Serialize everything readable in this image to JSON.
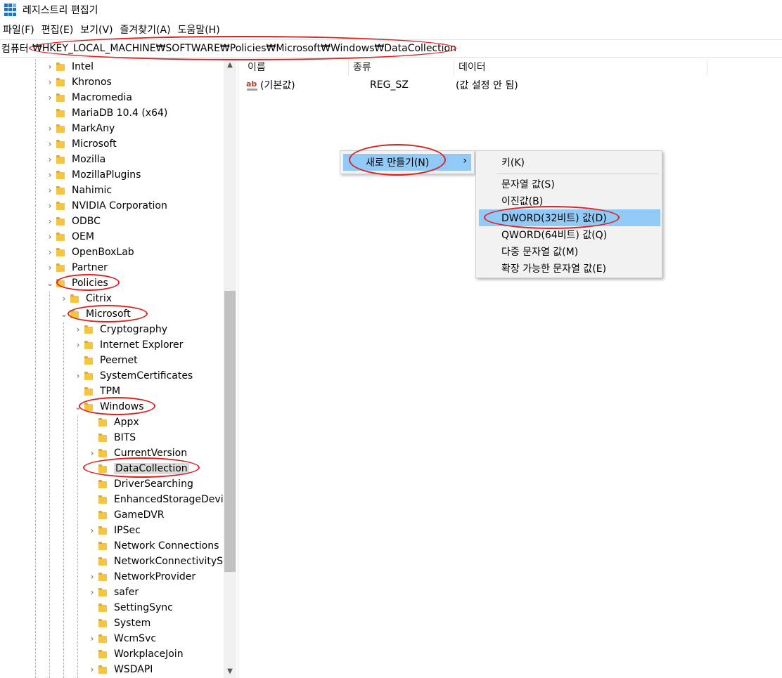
{
  "title": "레지스트리 편집기",
  "menu": [
    "파일(F)",
    "편집(E)",
    "보기(V)",
    "즐겨찾기(A)",
    "도움말(H)"
  ],
  "address": {
    "label": "컴퓨터",
    "path": "₩HKEY_LOCAL_MACHINE₩SOFTWARE₩Policies₩Microsoft₩Windows₩DataCollection"
  },
  "tree": [
    {
      "label": "Intel",
      "expander": "›"
    },
    {
      "label": "Khronos",
      "expander": "›"
    },
    {
      "label": "Macromedia",
      "expander": "›"
    },
    {
      "label": "MariaDB 10.4 (x64)",
      "expander": ""
    },
    {
      "label": "MarkAny",
      "expander": "›"
    },
    {
      "label": "Microsoft",
      "expander": "›"
    },
    {
      "label": "Mozilla",
      "expander": "›"
    },
    {
      "label": "MozillaPlugins",
      "expander": "›"
    },
    {
      "label": "Nahimic",
      "expander": "›"
    },
    {
      "label": "NVIDIA Corporation",
      "expander": "›"
    },
    {
      "label": "ODBC",
      "expander": "›"
    },
    {
      "label": "OEM",
      "expander": "›"
    },
    {
      "label": "OpenBoxLab",
      "expander": "›"
    },
    {
      "label": "Partner",
      "expander": "›"
    },
    {
      "label": "Policies",
      "expander": "⌄"
    },
    {
      "label": "Citrix",
      "expander": "›"
    },
    {
      "label": "Microsoft",
      "expander": "⌄"
    },
    {
      "label": "Cryptography",
      "expander": "›"
    },
    {
      "label": "Internet Explorer",
      "expander": "›"
    },
    {
      "label": "Peernet",
      "expander": ""
    },
    {
      "label": "SystemCertificates",
      "expander": "›"
    },
    {
      "label": "TPM",
      "expander": ""
    },
    {
      "label": "Windows",
      "expander": "⌄"
    },
    {
      "label": "Appx",
      "expander": ""
    },
    {
      "label": "BITS",
      "expander": ""
    },
    {
      "label": "CurrentVersion",
      "expander": "›"
    },
    {
      "label": "DataCollection",
      "expander": ""
    },
    {
      "label": "DriverSearching",
      "expander": ""
    },
    {
      "label": "EnhancedStorageDevi",
      "expander": ""
    },
    {
      "label": "GameDVR",
      "expander": ""
    },
    {
      "label": "IPSec",
      "expander": "›"
    },
    {
      "label": "Network Connections",
      "expander": ""
    },
    {
      "label": "NetworkConnectivityS",
      "expander": ""
    },
    {
      "label": "NetworkProvider",
      "expander": "›"
    },
    {
      "label": "safer",
      "expander": "›"
    },
    {
      "label": "SettingSync",
      "expander": ""
    },
    {
      "label": "System",
      "expander": ""
    },
    {
      "label": "WcmSvc",
      "expander": "›"
    },
    {
      "label": "WorkplaceJoin",
      "expander": ""
    },
    {
      "label": "WSDAPI",
      "expander": "›"
    }
  ],
  "list": {
    "headers": {
      "name": "이름",
      "type": "종류",
      "data": "데이터"
    },
    "rows": [
      {
        "icon": "ab-string-icon",
        "name": "(기본값)",
        "type": "REG_SZ",
        "data": "(값 설정 안 됨)"
      }
    ]
  },
  "context_menu": {
    "new_label": "새로 만들기(N)",
    "arrow": "›",
    "submenu": [
      "키(K)",
      "문자열 값(S)",
      "이진값(B)",
      "DWORD(32비트) 값(D)",
      "QWORD(64비트) 값(Q)",
      "다중 문자열 값(M)",
      "확장 가능한 문자열 값(E)"
    ]
  },
  "scrollbar": {
    "up": "▲",
    "down": "▼"
  },
  "colors": {
    "highlight": "#91c9f7",
    "annotation": "#e02020",
    "folder": "#f4c542"
  }
}
